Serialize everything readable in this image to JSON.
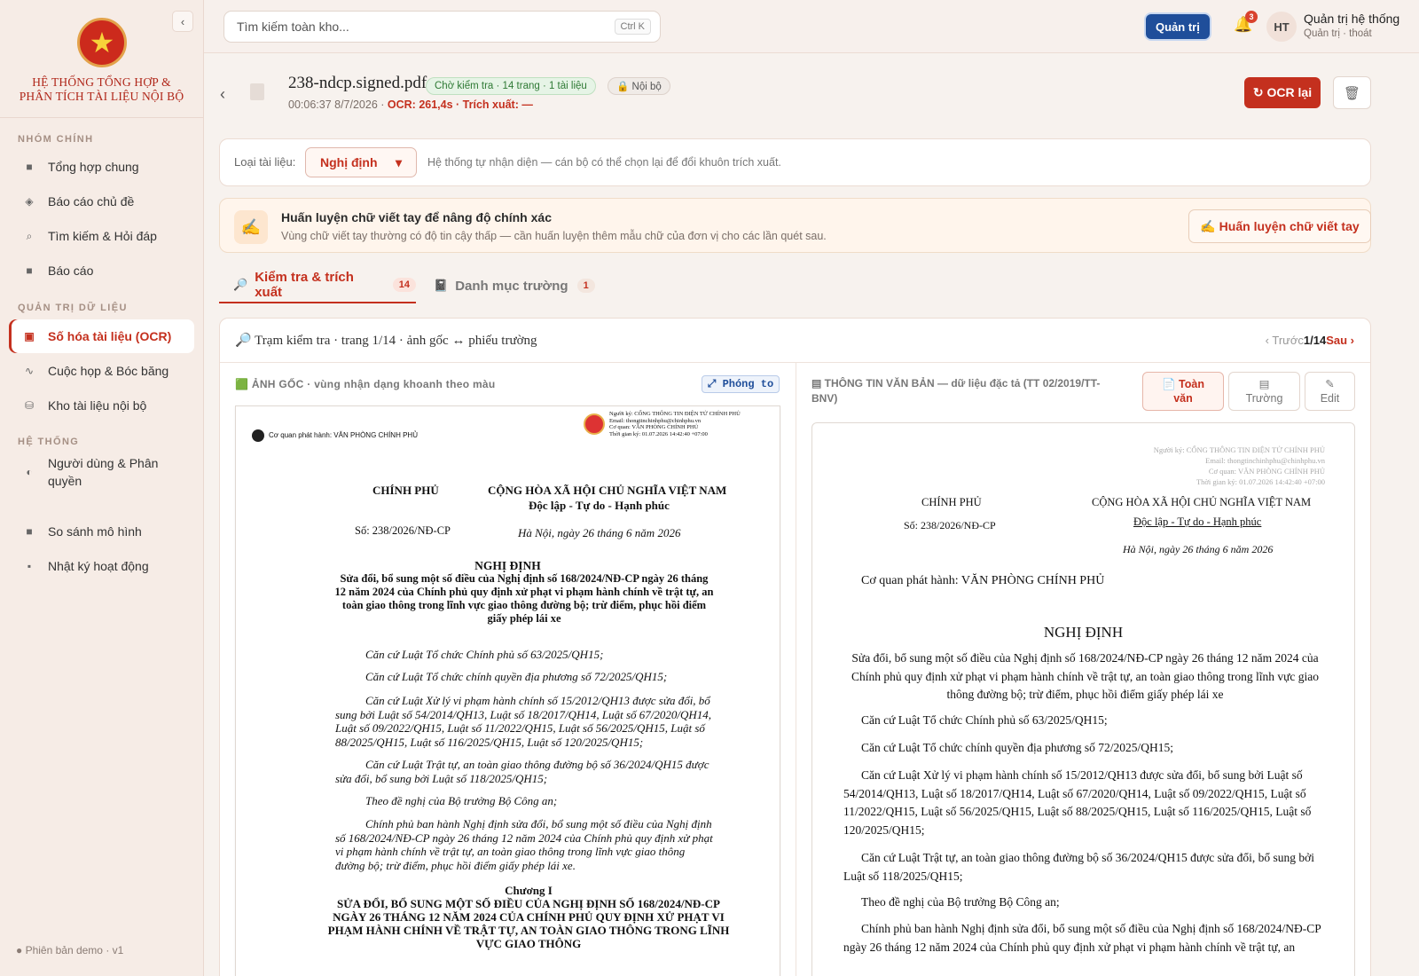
{
  "app": {
    "title_line1": "HỆ THỐNG TỔNG HỢP &",
    "title_line2": "PHÂN TÍCH TÀI LIỆU NỘI BỘ",
    "collapse": "‹",
    "version": "● Phiên bản demo · v1"
  },
  "sidebar": {
    "groups": [
      "NHÓM CHÍNH",
      "QUẢN TRỊ DỮ LIỆU",
      "HỆ THỐNG"
    ],
    "items": [
      {
        "label": "Tổng hợp chung",
        "icon": "■"
      },
      {
        "label": "Báo cáo chủ đề",
        "icon": "◈"
      },
      {
        "label": "Tìm kiếm & Hỏi đáp",
        "icon": "⌕"
      },
      {
        "label": "Báo cáo",
        "icon": "■"
      },
      {
        "label": "Số hóa tài liệu (OCR)",
        "icon": "▣"
      },
      {
        "label": "Cuộc họp & Bóc băng",
        "icon": "∿"
      },
      {
        "label": "Kho tài liệu nội bộ",
        "icon": "⛁"
      },
      {
        "label": "Người dùng & Phân quyền",
        "icon": "◐"
      },
      {
        "label": "So sánh mô hình",
        "icon": "■"
      },
      {
        "label": "Nhật ký hoạt động",
        "icon": "▪"
      }
    ]
  },
  "topbar": {
    "search_placeholder": "Tìm kiếm toàn kho...",
    "search_shortcut": "Ctrl K",
    "admin_label": "Quản trị",
    "notification_count": "3",
    "avatar_initials": "HT",
    "user_name": "Quản trị hệ thống",
    "user_sub": "Quản trị · thoát"
  },
  "document": {
    "back": "‹",
    "filename": "238-ndcp.signed.pdf",
    "status_tag": "Chờ kiểm tra · 14 trang · 1 tài liệu",
    "access_tag": "🔒 Nội bộ",
    "time": "00:06:37 8/7/2026 · ",
    "ocr_time": "OCR: 261,4s · Trích xuất: —",
    "ocr_again": "↻ OCR lại",
    "delete": "🗑"
  },
  "doc_type": {
    "label": "Loại tài liệu:",
    "selected": "Nghị định",
    "caret": "▾",
    "hint": "Hệ thống tự nhận diện — cán bộ có thể chọn lại để đổi khuôn trích xuất."
  },
  "training": {
    "icon": "✍",
    "title": "Huấn luyện chữ viết tay để nâng độ chính xác",
    "subtitle": "Vùng chữ viết tay thường có độ tin cậy thấp — cần huấn luyện thêm mẫu chữ của đơn vị cho các lần quét sau.",
    "button": "✍ Huấn luyện chữ viết tay"
  },
  "tabs": [
    {
      "icon": "🔎",
      "label": "Kiểm tra & trích xuất",
      "count": "14"
    },
    {
      "icon": "📓",
      "label": "Danh mục trường",
      "count": "1"
    }
  ],
  "station": {
    "title": "🔎 Trạm kiểm tra · trang 1/14 · ảnh gốc ↔ phiếu trường",
    "prev": "‹ Trước",
    "page": "1/14",
    "next": "Sau ›",
    "left_caption": "🟩 ẢNH GỐC · vùng nhận dạng khoanh theo màu",
    "zoom": "⤢ Phóng to",
    "right_caption": "▤ THÔNG TIN VĂN BẢN — dữ liệu đặc tả (TT 02/2019/TT-BNV)",
    "btn_fulltext_icon": "📄 Toàn",
    "btn_fulltext_2": "văn",
    "btn_fields_icon": "▤",
    "btn_fields": "Trường",
    "btn_edit_icon": "✎",
    "btn_edit": "Edit"
  },
  "scan": {
    "issuer": "Cơ quan phát hành: VĂN PHÒNG CHÍNH PHỦ",
    "sig": [
      "Người ký: CỔNG THÔNG TIN ĐIỆN TỬ CHÍNH PHỦ",
      "Email: thongtinchinhphu@chinhphu.vn",
      "Cơ quan: VĂN PHÒNG CHÍNH PHỦ",
      "Thời gian ký: 01.07.2026 14:42:40 +07:00"
    ],
    "gov": "CHÍNH PHỦ",
    "republic": "CỘNG HÒA XÃ HỘI CHỦ NGHĨA VIỆT NAM",
    "motto": "Độc lập - Tự do - Hạnh phúc",
    "number": "Số: 238/2026/NĐ-CP",
    "date": "Hà Nội, ngày 26 tháng 6 năm 2026",
    "heading": "NGHỊ ĐỊNH",
    "subject": "Sửa đổi, bổ sung một số điều của Nghị định số 168/2024/NĐ-CP ngày 26 tháng 12 năm 2024 của Chính phủ quy định xử phạt vi phạm hành chính về trật tự, an toàn giao thông trong lĩnh vực giao thông đường bộ; trừ điểm, phục hồi điểm giấy phép lái xe",
    "p1": "Căn cứ Luật Tổ chức Chính phủ số 63/2025/QH15;",
    "p2": "Căn cứ Luật Tổ chức chính quyền địa phương số 72/2025/QH15;",
    "p3": "Căn cứ Luật Xử lý vi phạm hành chính số 15/2012/QH13 được sửa đổi, bổ sung bởi Luật số 54/2014/QH13, Luật số 18/2017/QH14, Luật số 67/2020/QH14, Luật số 09/2022/QH15, Luật số 11/2022/QH15, Luật số 56/2025/QH15, Luật số 88/2025/QH15, Luật số 116/2025/QH15, Luật số 120/2025/QH15;",
    "p4": "Căn cứ Luật Trật tự, an toàn giao thông đường bộ số 36/2024/QH15 được sửa đổi, bổ sung bởi Luật số 118/2025/QH15;",
    "p5": "Theo đề nghị của Bộ trưởng Bộ Công an;",
    "p6": "Chính phủ ban hành Nghị định sửa đổi, bổ sung một số điều của Nghị định số 168/2024/NĐ-CP ngày 26 tháng 12 năm 2024 của Chính phủ quy định xử phạt vi phạm hành chính về trật tự, an toàn giao thông trong lĩnh vực giao thông đường bộ; trừ điểm, phục hồi điểm giấy phép lái xe.",
    "chapter": "Chương I",
    "chapter_title": "SỬA ĐỔI, BỔ SUNG MỘT SỐ ĐIỀU CỦA NGHỊ ĐỊNH SỐ 168/2024/NĐ-CP NGÀY 26 THÁNG 12 NĂM 2024 CỦA CHÍNH PHỦ QUY ĐỊNH XỬ PHẠT VI PHẠM HÀNH CHÍNH VỀ TRẬT TỰ, AN TOÀN GIAO THÔNG TRONG LĨNH VỰC GIAO THÔNG"
  },
  "fulltext": {
    "sig": [
      "Người ký: CỔNG THÔNG TIN ĐIỆN TỬ CHÍNH PHỦ",
      "Email: thongtinchinhphu@chinhphu.vn",
      "Cơ quan: VĂN PHÒNG CHÍNH PHỦ",
      "Thời gian ký: 01.07.2026 14:42:40 +07:00"
    ],
    "gov": "CHÍNH PHỦ",
    "number": "Số: 238/2026/NĐ-CP",
    "republic": "CỘNG HÒA XÃ HỘI CHỦ NGHĨA VIỆT NAM",
    "motto": "Độc lập - Tự do - Hạnh phúc",
    "date": "Hà Nội, ngày 26 tháng 6 năm 2026",
    "issuer": "Cơ quan phát hành: VĂN PHÒNG CHÍNH PHỦ",
    "heading": "NGHỊ ĐỊNH",
    "subject": "Sửa đổi, bổ sung một số điều của Nghị định số 168/2024/NĐ-CP ngày 26 tháng 12 năm 2024 của Chính phủ quy định xử phạt vi phạm hành chính về trật tự, an toàn giao thông trong lĩnh vực giao thông đường bộ; trừ điểm, phục hồi điểm giấy phép lái xe",
    "p1": "Căn cứ Luật Tổ chức Chính phủ số 63/2025/QH15;",
    "p2": "Căn cứ Luật Tổ chức chính quyền địa phương số 72/2025/QH15;",
    "p3": "Căn cứ Luật Xử lý vi phạm hành chính số 15/2012/QH13 được sửa đổi, bổ sung bởi Luật số 54/2014/QH13, Luật số 18/2017/QH14, Luật số 67/2020/QH14, Luật số 09/2022/QH15, Luật số 11/2022/QH15, Luật số 56/2025/QH15, Luật số 88/2025/QH15, Luật số 116/2025/QH15, Luật số 120/2025/QH15;",
    "p4": "Căn cứ Luật Trật tự, an toàn giao thông đường bộ số 36/2024/QH15 được sửa đổi, bổ sung bởi Luật số 118/2025/QH15;",
    "p5": "Theo đề nghị của Bộ trưởng Bộ Công an;",
    "p6": "Chính phủ ban hành Nghị định sửa đổi, bổ sung một số điều của Nghị định số 168/2024/NĐ-CP ngày 26 tháng 12 năm 2024 của Chính phủ quy định xử phạt vi phạm hành chính về trật tự, an"
  }
}
